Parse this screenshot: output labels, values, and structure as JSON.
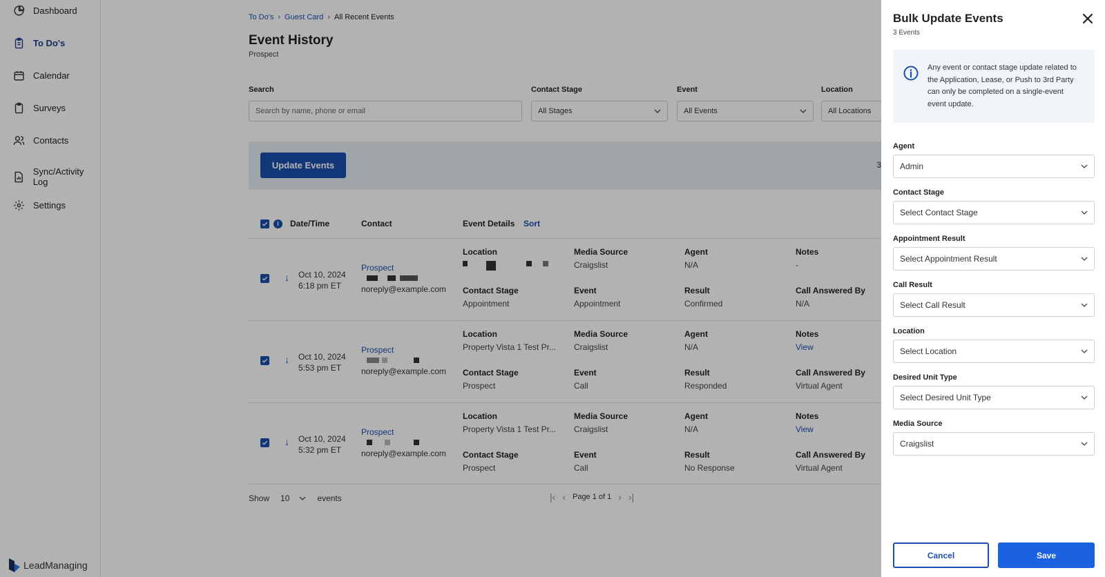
{
  "sidebar": {
    "items": [
      {
        "label": "Dashboard",
        "icon": "pie-chart-icon"
      },
      {
        "label": "To Do's",
        "icon": "clipboard-list-icon",
        "active": true
      },
      {
        "label": "Calendar",
        "icon": "calendar-icon"
      },
      {
        "label": "Surveys",
        "icon": "clipboard-icon"
      },
      {
        "label": "Contacts",
        "icon": "users-icon"
      },
      {
        "label": "Sync/Activity Log",
        "icon": "document-chart-icon"
      },
      {
        "label": "Settings",
        "icon": "gear-icon"
      }
    ],
    "logo_text": "LeadManaging"
  },
  "breadcrumb": {
    "items": [
      "To Do's",
      "Guest Card",
      "All Recent Events"
    ]
  },
  "page": {
    "title": "Event History",
    "subtitle": "Prospect"
  },
  "filters": {
    "search_label": "Search",
    "search_placeholder": "Search by name, phone or email",
    "stage_label": "Contact Stage",
    "stage_value": "All Stages",
    "event_label": "Event",
    "event_value": "All Events",
    "location_label": "Location",
    "location_value": "All Locations"
  },
  "action_bar": {
    "update_label": "Update Events",
    "selected_count": "3"
  },
  "table": {
    "headers": {
      "datetime": "Date/Time",
      "contact": "Contact",
      "details": "Event Details",
      "sort": "Sort"
    },
    "field_labels": {
      "location": "Location",
      "media_source": "Media Source",
      "agent": "Agent",
      "notes": "Notes",
      "contact_stage": "Contact Stage",
      "event": "Event",
      "result": "Result",
      "call_answered_by": "Call Answered By"
    },
    "rows": [
      {
        "date": "Oct 10, 2024",
        "time": "6:18 pm ET",
        "contact_name": "Prospect",
        "email": "noreply@example.com",
        "location": "",
        "media_source": "Craigslist",
        "agent": "N/A",
        "notes": "-",
        "contact_stage": "Appointment",
        "event": "Appointment",
        "result": "Confirmed",
        "call_answered_by": "N/A"
      },
      {
        "date": "Oct 10, 2024",
        "time": "5:53 pm ET",
        "contact_name": "Prospect",
        "email": "noreply@example.com",
        "location": "Property Vista 1 Test Pr...",
        "media_source": "Craigslist",
        "agent": "N/A",
        "notes": "View",
        "contact_stage": "Prospect",
        "event": "Call",
        "result": "Responded",
        "call_answered_by": "Virtual Agent"
      },
      {
        "date": "Oct 10, 2024",
        "time": "5:32 pm ET",
        "contact_name": "Prospect",
        "email": "noreply@example.com",
        "location": "Property Vista 1 Test Pr...",
        "media_source": "Craigslist",
        "agent": "N/A",
        "notes": "View",
        "contact_stage": "Prospect",
        "event": "Call",
        "result": "No Response",
        "call_answered_by": "Virtual Agent"
      }
    ]
  },
  "footer": {
    "show_label": "Show",
    "page_size": "10",
    "events_label": "events",
    "page_info": "Page 1 of 1"
  },
  "panel": {
    "title": "Bulk Update Events",
    "subtitle": "3 Events",
    "notice": "Any event or contact stage update related to the Application, Lease, or Push to 3rd Party can only be completed on a single-event event update.",
    "fields": [
      {
        "label": "Agent",
        "value": "Admin"
      },
      {
        "label": "Contact Stage",
        "value": "Select Contact Stage"
      },
      {
        "label": "Appointment Result",
        "value": "Select Appointment Result"
      },
      {
        "label": "Call Result",
        "value": "Select Call Result"
      },
      {
        "label": "Location",
        "value": "Select Location"
      },
      {
        "label": "Desired Unit Type",
        "value": "Select Desired Unit Type"
      },
      {
        "label": "Media Source",
        "value": "Craigslist"
      }
    ],
    "cancel_label": "Cancel",
    "save_label": "Save"
  },
  "colors": {
    "primary": "#1a4fae",
    "save": "#1a62e0",
    "notice_bg": "#eef4f7"
  }
}
